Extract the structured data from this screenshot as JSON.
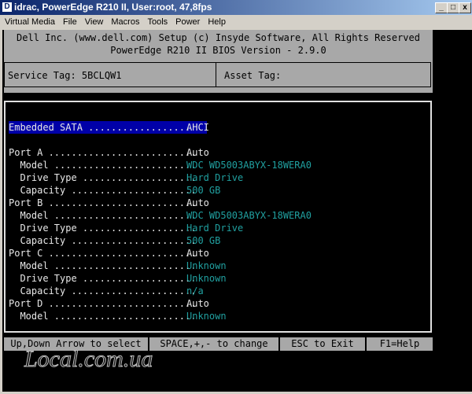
{
  "window": {
    "title": "idrac, PowerEdge R210 II, User:root, 47,8fps",
    "icon": "D"
  },
  "menu": [
    "Virtual Media",
    "File",
    "View",
    "Macros",
    "Tools",
    "Power",
    "Help"
  ],
  "bios": {
    "line1": "Dell Inc. (www.dell.com)  Setup (c) Insyde Software, All Rights Reserved",
    "line2": "PowerEdge R210 II   BIOS Version - 2.9.0",
    "service_tag": "Service Tag: 5BCLQW1",
    "asset_tag": "Asset Tag:"
  },
  "rows": [
    {
      "label": "Embedded SATA ..................",
      "value": "AHCI"
    },
    {
      "label": "Port A ..........................",
      "value": "Auto"
    },
    {
      "label": "  Model .........................",
      "value": "WDC WD5003ABYX-18WERA0"
    },
    {
      "label": "  Drive Type ....................",
      "value": "Hard Drive"
    },
    {
      "label": "  Capacity ......................",
      "value": "500 GB"
    },
    {
      "label": "Port B ..........................",
      "value": "Auto"
    },
    {
      "label": "  Model .........................",
      "value": "WDC WD5003ABYX-18WERA0"
    },
    {
      "label": "  Drive Type ....................",
      "value": "Hard Drive"
    },
    {
      "label": "  Capacity ......................",
      "value": "500 GB"
    },
    {
      "label": "Port C ..........................",
      "value": "Auto"
    },
    {
      "label": "  Model .........................",
      "value": "Unknown"
    },
    {
      "label": "  Drive Type ....................",
      "value": "Unknown"
    },
    {
      "label": "  Capacity ......................",
      "value": "n/a"
    },
    {
      "label": "Port D ..........................",
      "value": "Auto"
    },
    {
      "label": "  Model .........................",
      "value": "Unknown"
    }
  ],
  "footer": [
    "Up,Down Arrow to select",
    "SPACE,+,- to change",
    "ESC to Exit",
    "F1=Help"
  ],
  "watermark": "Local.com.ua"
}
